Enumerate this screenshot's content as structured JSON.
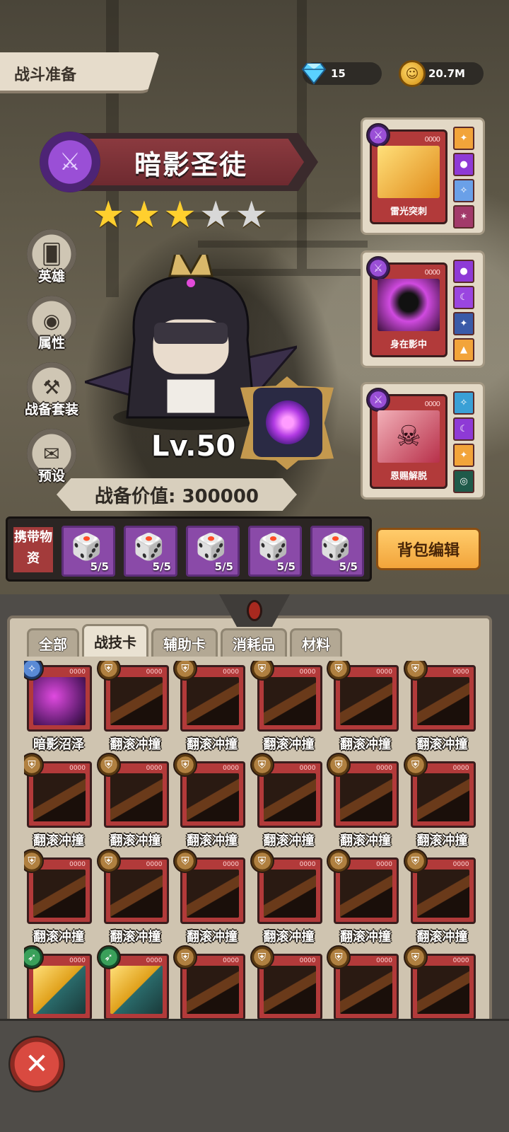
{
  "header": {
    "title": "战斗准备",
    "gems": "15",
    "gold": "20.7M"
  },
  "hero": {
    "name": "暗影圣徒",
    "stars_filled": 3,
    "stars_total": 5,
    "level": "Lv.50",
    "power_label": "战备价值: 300000"
  },
  "side_menu": [
    {
      "label": "英雄",
      "icon": "cards-icon"
    },
    {
      "label": "属性",
      "icon": "eye-icon"
    },
    {
      "label": "战备套装",
      "icon": "anvil-icon"
    },
    {
      "label": "预设",
      "icon": "scroll-icon"
    }
  ],
  "skills": [
    {
      "name": "雷光突刺",
      "pips": "0000",
      "color": "#f2b23b"
    },
    {
      "name": "身在影中",
      "pips": "0000",
      "color": "#c43bd6"
    },
    {
      "name": "恩赐解脱",
      "pips": "0000",
      "color": "#d97a8a"
    }
  ],
  "carry": {
    "label": "携带物资",
    "slots": [
      {
        "count": "5/5",
        "icon": "mystery-dice-icon"
      },
      {
        "count": "5/5",
        "icon": "orange-dice-icon"
      },
      {
        "count": "5/5",
        "icon": "pink-dice-icon"
      },
      {
        "count": "5/5",
        "icon": "purple-dice-icon"
      },
      {
        "count": "5/5",
        "icon": "orange-dice-icon"
      }
    ]
  },
  "bag_button": "背包编辑",
  "tabs": [
    "全部",
    "战技卡",
    "辅助卡",
    "消耗品",
    "材料"
  ],
  "active_tab": 1,
  "cards": [
    {
      "name": "暗影沼泽",
      "type": "magic",
      "pips": "0000"
    },
    {
      "name": "翻滚冲撞",
      "type": "shield",
      "pips": "0000"
    },
    {
      "name": "翻滚冲撞",
      "type": "shield",
      "pips": "0000"
    },
    {
      "name": "翻滚冲撞",
      "type": "shield",
      "pips": "0000"
    },
    {
      "name": "翻滚冲撞",
      "type": "shield",
      "pips": "0000"
    },
    {
      "name": "翻滚冲撞",
      "type": "shield",
      "pips": "0000"
    },
    {
      "name": "翻滚冲撞",
      "type": "shield",
      "pips": "0000"
    },
    {
      "name": "翻滚冲撞",
      "type": "shield",
      "pips": "0000"
    },
    {
      "name": "翻滚冲撞",
      "type": "shield",
      "pips": "0000"
    },
    {
      "name": "翻滚冲撞",
      "type": "shield",
      "pips": "0000"
    },
    {
      "name": "翻滚冲撞",
      "type": "shield",
      "pips": "0000"
    },
    {
      "name": "翻滚冲撞",
      "type": "shield",
      "pips": "0000"
    },
    {
      "name": "翻滚冲撞",
      "type": "shield",
      "pips": "0000"
    },
    {
      "name": "翻滚冲撞",
      "type": "shield",
      "pips": "0000"
    },
    {
      "name": "翻滚冲撞",
      "type": "shield",
      "pips": "0000"
    },
    {
      "name": "翻滚冲撞",
      "type": "shield",
      "pips": "0000"
    },
    {
      "name": "翻滚冲撞",
      "type": "shield",
      "pips": "0000"
    },
    {
      "name": "翻滚冲撞",
      "type": "shield",
      "pips": "0000"
    },
    {
      "name": "",
      "type": "arrow",
      "pips": "0000"
    },
    {
      "name": "",
      "type": "arrow",
      "pips": "0000"
    },
    {
      "name": "",
      "type": "shield",
      "pips": "0000"
    },
    {
      "name": "",
      "type": "shield",
      "pips": "0000"
    },
    {
      "name": "",
      "type": "shield",
      "pips": "0000"
    },
    {
      "name": "",
      "type": "shield",
      "pips": "0000"
    }
  ],
  "close_label": "✕"
}
